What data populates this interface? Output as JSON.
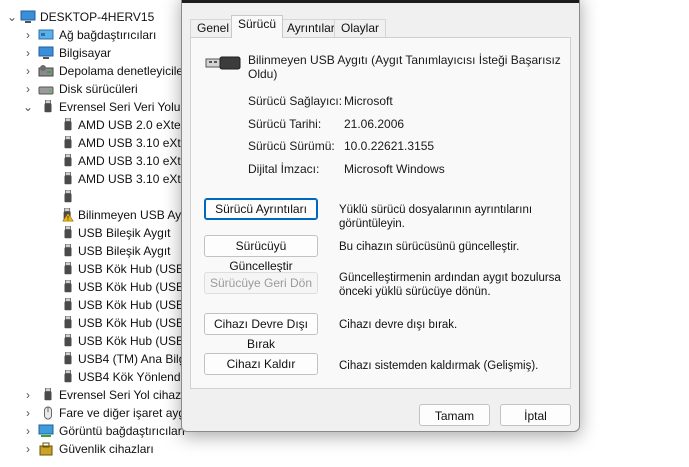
{
  "tree": {
    "root": "DESKTOP-4HERV15",
    "items": [
      {
        "label": "Ağ bağdaştırıcıları",
        "icon": "network-adapter-icon"
      },
      {
        "label": "Bilgisayar",
        "icon": "computer-icon"
      },
      {
        "label": "Depolama denetleyicile",
        "icon": "storage-controller-icon"
      },
      {
        "label": "Disk sürücüleri",
        "icon": "disk-drive-icon"
      },
      {
        "label": "Evrensel Seri Veri Yolu d",
        "icon": "usb-icon"
      },
      {
        "label": "AMD USB 2.0 eXten",
        "icon": "usb-icon"
      },
      {
        "label": "AMD USB 3.10 eXte",
        "icon": "usb-icon"
      },
      {
        "label": "AMD USB 3.10 eXte",
        "icon": "usb-icon"
      },
      {
        "label": "AMD USB 3.10 eXte",
        "icon": "usb-icon"
      },
      {
        "label": "Bilinmeyen USB Ayg",
        "icon": "usb-warning-icon"
      },
      {
        "label": "USB Bileşik Aygıt",
        "icon": "usb-icon"
      },
      {
        "label": "USB Bileşik Aygıt",
        "icon": "usb-icon"
      },
      {
        "label": "USB Kök Hub (USB",
        "icon": "usb-icon"
      },
      {
        "label": "USB Kök Hub (USB",
        "icon": "usb-icon"
      },
      {
        "label": "USB Kök Hub (USB",
        "icon": "usb-icon"
      },
      {
        "label": "USB Kök Hub (USB",
        "icon": "usb-icon"
      },
      {
        "label": "USB Kök Hub (USB",
        "icon": "usb-icon"
      },
      {
        "label": "USB4 (TM) Ana Bilg",
        "icon": "usb-icon"
      },
      {
        "label": "USB4 Kök Yönlendir",
        "icon": "usb-icon"
      },
      {
        "label": "Evrensel Seri Yol cihazla",
        "icon": "usb-icon"
      },
      {
        "label": "Fare ve diğer işaret ayg",
        "icon": "mouse-icon"
      },
      {
        "label": "Görüntü bağdaştırıcıları",
        "icon": "display-adapter-icon"
      },
      {
        "label": "Güvenlik cihazları",
        "icon": "security-device-icon"
      }
    ]
  },
  "dialog": {
    "tabs": [
      "Genel",
      "Sürücü",
      "Ayrıntılar",
      "Olaylar"
    ],
    "active_tab": "Sürücü",
    "device_name": "Bilinmeyen USB Aygıtı (Aygıt Tanımlayıcısı İsteği Başarısız Oldu)",
    "properties": [
      {
        "label": "Sürücü Sağlayıcı:",
        "value": "Microsoft"
      },
      {
        "label": "Sürücü Tarihi:",
        "value": "21.06.2006"
      },
      {
        "label": "Sürücü Sürümü:",
        "value": "10.0.22621.3155"
      },
      {
        "label": "Dijital İmzacı:",
        "value": "Microsoft Windows"
      }
    ],
    "actions": [
      {
        "button": "Sürücü Ayrıntıları",
        "description": "Yüklü sürücü dosyalarının ayrıntılarını görüntüleyin."
      },
      {
        "button": "Sürücüyü Güncelleştir",
        "description": "Bu cihazın sürücüsünü güncelleştir."
      },
      {
        "button": "Sürücüye Geri Dön",
        "description": "Güncelleştirmenin ardından aygıt bozulursa önceki yüklü sürücüye dönün."
      },
      {
        "button": "Cihazı Devre Dışı Bırak",
        "description": "Cihazı devre dışı bırak."
      },
      {
        "button": "Cihazı Kaldır",
        "description": "Cihazı sistemden kaldırmak (Gelişmiş)."
      }
    ],
    "ok_label": "Tamam",
    "cancel_label": "İptal"
  },
  "colors": {
    "accent": "#0067c0",
    "warning": "#f3b40a",
    "dialog_bg": "#f0f0f0"
  }
}
